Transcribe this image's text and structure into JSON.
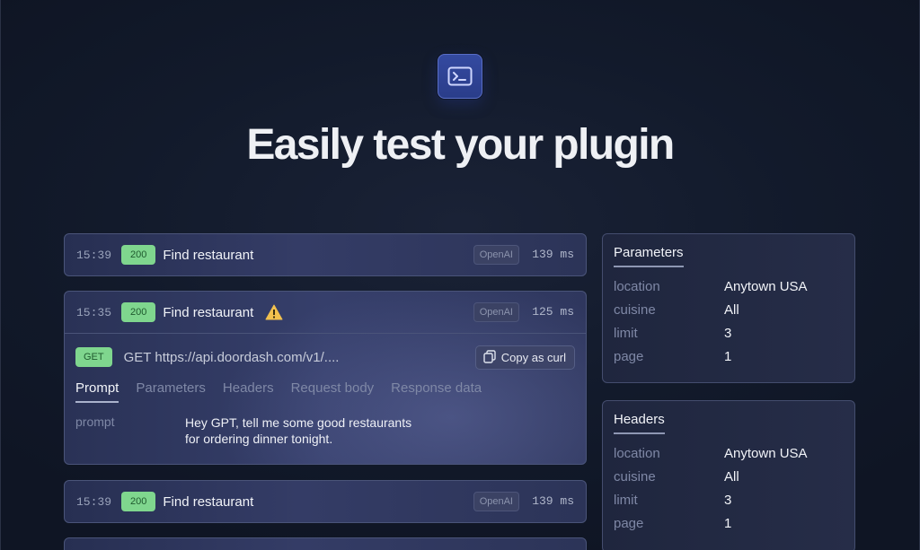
{
  "hero": {
    "icon": "terminal-icon",
    "title": "Easily test your plugin"
  },
  "log_rows": [
    {
      "time": "15:39",
      "status": "200",
      "title": "Find restaurant",
      "provider": "OpenAI",
      "duration": "139 ms"
    },
    {
      "time": "15:35",
      "status": "200",
      "title": "Find restaurant",
      "provider": "OpenAI",
      "duration": "125 ms",
      "warning_icon": "warning-triangle-icon"
    },
    {
      "time": "15:39",
      "status": "200",
      "title": "Find restaurant",
      "provider": "OpenAI",
      "duration": "139 ms"
    }
  ],
  "request": {
    "method": "GET",
    "url": "GET https://api.doordash.com/v1/....",
    "copy_label": "Copy as curl",
    "copy_icon": "copy-icon"
  },
  "tabs": [
    "Prompt",
    "Parameters",
    "Headers",
    "Request body",
    "Response data"
  ],
  "active_tab": "Prompt",
  "prompt": {
    "key": "prompt",
    "value_line1": "Hey GPT, tell me some good restaurants",
    "value_line2": "for ordering dinner tonight."
  },
  "parameters_panel": {
    "title": "Parameters",
    "items": [
      {
        "key": "location",
        "value": "Anytown USA"
      },
      {
        "key": "cuisine",
        "value": "All"
      },
      {
        "key": "limit",
        "value": "3"
      },
      {
        "key": "page",
        "value": "1"
      }
    ]
  },
  "headers_panel": {
    "title": "Headers",
    "items": [
      {
        "key": "location",
        "value": "Anytown USA"
      },
      {
        "key": "cuisine",
        "value": "All"
      },
      {
        "key": "limit",
        "value": "3"
      },
      {
        "key": "page",
        "value": "1"
      }
    ]
  },
  "colors": {
    "background": "#111827",
    "status_green": "#7fd68e",
    "accent_blue": "#344aa0",
    "warning": "#f2c14e"
  }
}
